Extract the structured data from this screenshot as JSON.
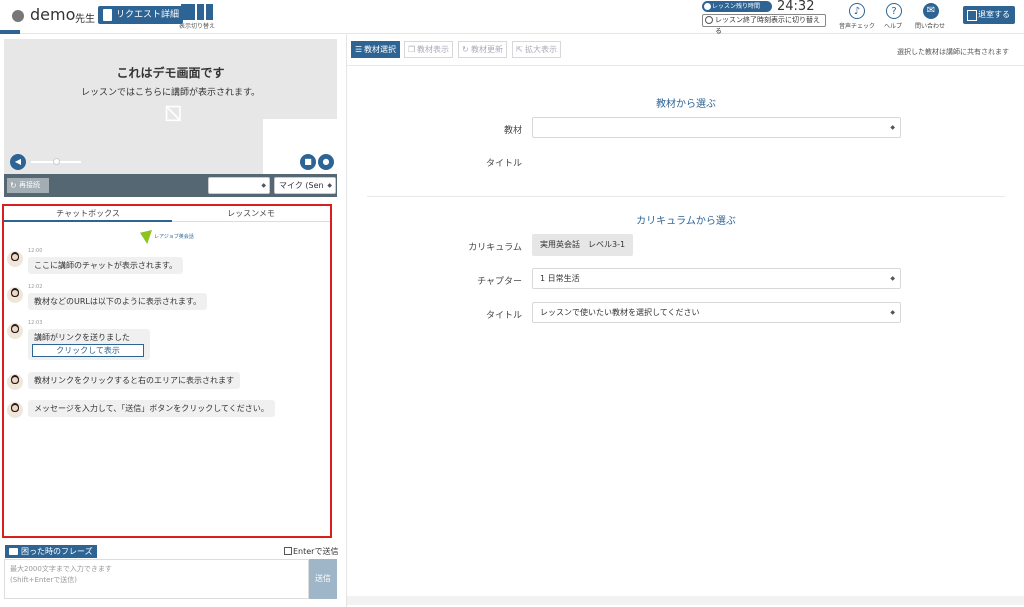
{
  "header": {
    "teacher_name": "demo",
    "teacher_suffix": "先生",
    "request_button": "リクエスト詳細",
    "layout_switch_label": "表示切り替え",
    "timer_badge": "レッスン残り時間",
    "timer_value": "24:32",
    "timer_toggle": "レッスン終了時刻表示に切り替える",
    "audio_check": "音声チェック",
    "help": "ヘルプ",
    "contact": "問い合わせ",
    "exit_button": "退室する"
  },
  "video": {
    "title": "これはデモ画面です",
    "subtitle": "レッスンではこちらに講師が表示されます。",
    "reconnect": "再接続",
    "camera_select": "",
    "mic_select": "マイク (Sen"
  },
  "chat": {
    "tabs": [
      "チャットボックス",
      "レッスンメモ"
    ],
    "logo_text": "レアジョブ英会話",
    "messages": [
      {
        "time": "12:00",
        "text": "ここに講師のチャットが表示されます。"
      },
      {
        "time": "12:02",
        "text": "教材などのURLは以下のように表示されます。"
      },
      {
        "time": "12:03",
        "text": "講師がリンクを送りました",
        "button": "クリックして表示"
      },
      {
        "time": "",
        "text": "教材リンクをクリックすると右のエリアに表示されます"
      },
      {
        "time": "",
        "text": "メッセージを入力して、「送信」ボタンをクリックしてください。"
      }
    ],
    "phrase_button": "困った時のフレーズ",
    "enter_send": "Enterで送信",
    "input_placeholder_1": "最大2000文字まで入力できます",
    "input_placeholder_2": "(Shift+Enterで送信)",
    "send_button": "送信"
  },
  "materials": {
    "toolbar": [
      "教材選択",
      "教材表示",
      "教材更新",
      "拡大表示"
    ],
    "share_note": "選択した教材は講師に共有されます",
    "from_materials_title": "教材から選ぶ",
    "material_label": "教材",
    "material_value": "",
    "title_label": "タイトル",
    "from_curriculum_title": "カリキュラムから選ぶ",
    "curriculum_label": "カリキュラム",
    "curriculum_value": "実用英会話　レベル3-1",
    "chapter_label": "チャプター",
    "chapter_value": "1 日常生活",
    "title2_label": "タイトル",
    "title2_placeholder": "レッスンで使いたい教材を選択してください"
  },
  "colors": {
    "accent": "#2d6494",
    "highlight_border": "#d91e1e"
  }
}
